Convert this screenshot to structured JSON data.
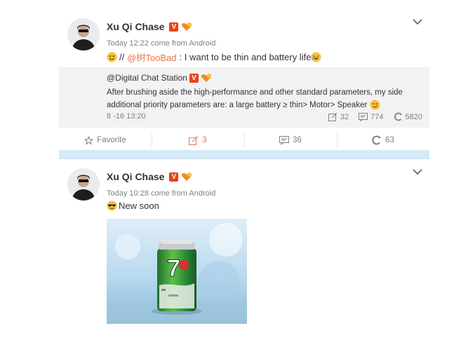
{
  "posts": [
    {
      "author": "Xu Qi Chase",
      "meta": "Today 12:22 come from Android",
      "text_prefix": "//",
      "mention": "@树TooBad",
      "text_suffix": ": I want to be thin and battery life",
      "repost": {
        "author": "@Digital Chat Station",
        "body": "After brushing aside the high-performance and other standard parameters, my side additional priority parameters are: a large battery ≥ thin> Motor> Speaker",
        "time": "8 -16 13:20",
        "stats": {
          "reposts": "32",
          "comments": "774",
          "likes": "5820"
        }
      },
      "actions": {
        "favorite": "Favorite",
        "reposts": "3",
        "comments": "36",
        "likes": "63"
      }
    },
    {
      "author": "Xu Qi Chase",
      "meta": "Today 10:28 come from Android",
      "text": "New soon"
    }
  ],
  "icons": {
    "verified_badge": "v-badge-icon",
    "fan_badge": "fan-badge-icon",
    "chevron": "chevron-down-icon",
    "favorite": "star-icon",
    "repost": "repost-icon",
    "comment": "comment-icon",
    "like": "like-icon"
  },
  "colors": {
    "accent": "#eb7350",
    "muted": "#808080",
    "repost_bg": "#f2f2f5",
    "divider": "#d6eaf8"
  }
}
